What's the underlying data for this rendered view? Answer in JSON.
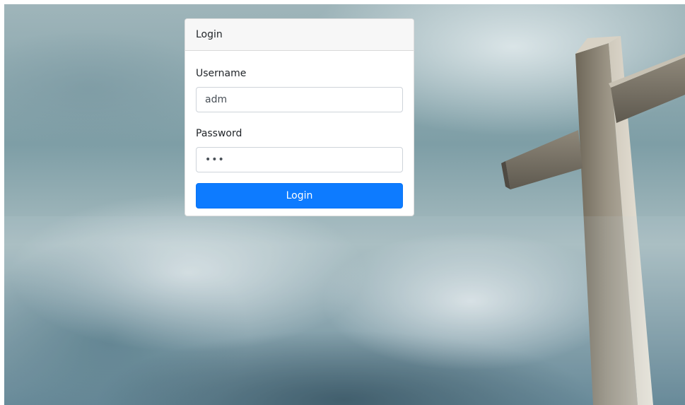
{
  "login_card": {
    "header_title": "Login",
    "username": {
      "label": "Username",
      "value": "adm"
    },
    "password": {
      "label": "Password",
      "value": "adm"
    },
    "submit_label": "Login"
  },
  "colors": {
    "primary_button": "#0d7bff",
    "card_header_bg": "#f7f7f7",
    "input_border": "#ced4da"
  }
}
